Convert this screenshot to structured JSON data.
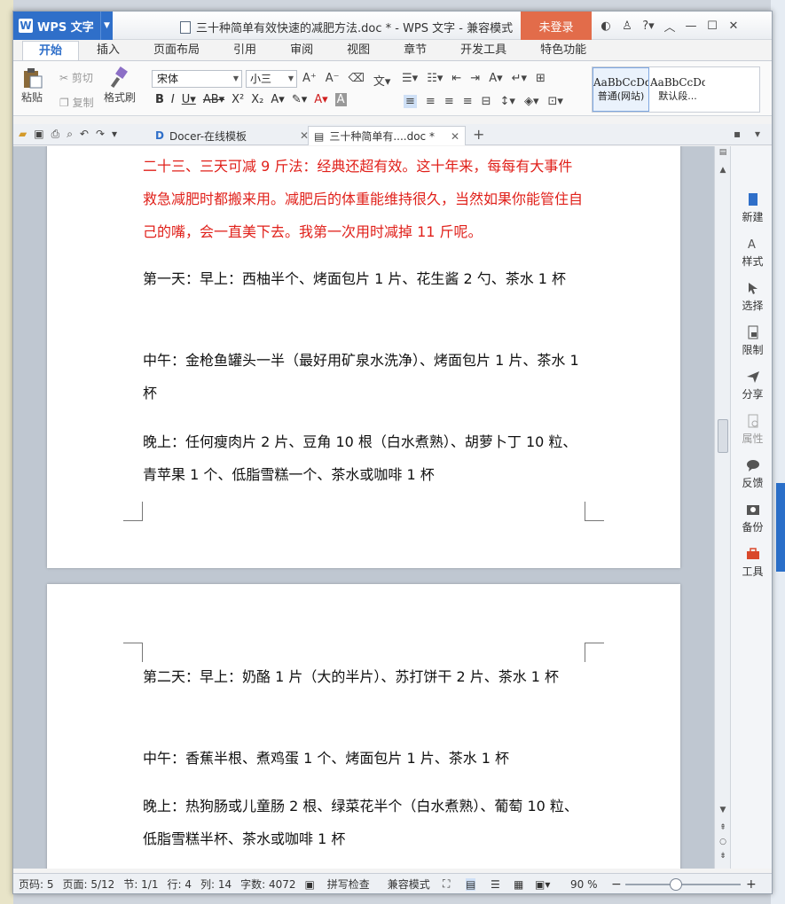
{
  "app": {
    "name": "WPS 文字",
    "window_title": "三十种简单有效快速的减肥方法.doc * - WPS 文字 - 兼容模式",
    "login": "未登录"
  },
  "ribbon_tabs": [
    "开始",
    "插入",
    "页面布局",
    "引用",
    "审阅",
    "视图",
    "章节",
    "开发工具",
    "特色功能"
  ],
  "ribbon": {
    "paste": "粘贴",
    "cut": "剪切",
    "copy": "复制",
    "format_painter": "格式刷",
    "font_name": "宋体",
    "font_size": "小三",
    "styles": [
      {
        "sample": "AaBbCcDd",
        "label": "普通(网站)"
      },
      {
        "sample": "AaBbCcDd",
        "label": "默认段..."
      }
    ]
  },
  "doc_tabs": [
    {
      "label": "Docer-在线模板",
      "active": false
    },
    {
      "label": "三十种简单有....doc *",
      "active": true
    }
  ],
  "document": {
    "page1": [
      {
        "text": "二十三、三天可减 9 斤法：经典还超有效。这十年来，每每有大事件救急减肥时都搬来用。减肥后的体重能维持很久，当然如果你能管住自己的嘴，会一直美下去。我第一次用时减掉 11 斤呢。",
        "color": "#e0201a"
      },
      {
        "text": " 第一天：早上：西柚半个、烤面包片 1 片、花生酱 2 勺、茶水 1 杯"
      },
      {
        "text": "中午：金枪鱼罐头一半（最好用矿泉水洗净）、烤面包片 1 片、茶水 1 杯"
      },
      {
        "text": "晚上：任何瘦肉片 2 片、豆角 10 根（白水煮熟）、胡萝卜丁 10 粒、青苹果 1 个、低脂雪糕一个、茶水或咖啡 1 杯"
      }
    ],
    "page2": [
      {
        "text": "第二天：早上：奶酪 1 片（大的半片）、苏打饼干 2 片、茶水 1 杯"
      },
      {
        "text": "中午：香蕉半根、煮鸡蛋 1 个、烤面包片 1 片、茶水 1 杯"
      },
      {
        "text": "晚上：热狗肠或儿童肠 2 根、绿菜花半个（白水煮熟）、葡萄 10 粒、低脂雪糕半杯、茶水或咖啡 1 杯"
      }
    ]
  },
  "right_panel": [
    "新建",
    "样式",
    "选择",
    "限制",
    "分享",
    "属性",
    "反馈",
    "备份",
    "工具"
  ],
  "status": {
    "page_num": "页码: 5",
    "pages": "页面: 5/12",
    "section": "节: 1/1",
    "line": "行: 4",
    "column": "列: 14",
    "word_count": "字数: 4072",
    "spellcheck": "拼写检查",
    "compat": "兼容模式",
    "zoom": "90 %"
  }
}
